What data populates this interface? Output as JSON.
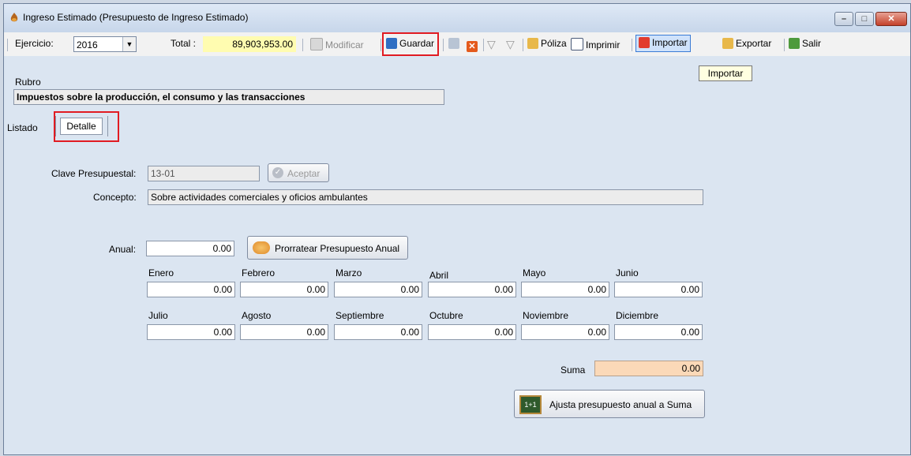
{
  "window": {
    "title": "Ingreso Estimado (Presupuesto de Ingreso Estimado)"
  },
  "toolbar": {
    "ejercicio_label": "Ejercicio:",
    "ejercicio_value": "2016",
    "total_label": "Total :",
    "total_value": "89,903,953.00",
    "modificar": "Modificar",
    "guardar": "Guardar",
    "poliza": "Póliza",
    "imprimir": "Imprimir",
    "importar": "Importar",
    "exportar": "Exportar",
    "salir": "Salir"
  },
  "tooltip": "Importar",
  "rubro": {
    "label": "Rubro",
    "value": "Impuestos sobre la producción, el consumo y las transacciones"
  },
  "tabs": {
    "listado": "Listado",
    "detalle": "Detalle"
  },
  "detalle": {
    "clave_label": "Clave Presupuestal:",
    "clave_value": "13-01",
    "aceptar": "Aceptar",
    "concepto_label": "Concepto:",
    "concepto_value": "Sobre actividades comerciales y oficios ambulantes",
    "anual_label": "Anual:",
    "anual_value": "0.00",
    "prorratear": "Prorratear Presupuesto Anual",
    "months": [
      {
        "label": "Enero",
        "value": "0.00"
      },
      {
        "label": "Febrero",
        "value": "0.00"
      },
      {
        "label": "Marzo",
        "value": "0.00"
      },
      {
        "label": "Abril",
        "value": "0.00"
      },
      {
        "label": "Mayo",
        "value": "0.00"
      },
      {
        "label": "Junio",
        "value": "0.00"
      },
      {
        "label": "Julio",
        "value": "0.00"
      },
      {
        "label": "Agosto",
        "value": "0.00"
      },
      {
        "label": "Septiembre",
        "value": "0.00"
      },
      {
        "label": "Octubre",
        "value": "0.00"
      },
      {
        "label": "Noviembre",
        "value": "0.00"
      },
      {
        "label": "Diciembre",
        "value": "0.00"
      }
    ],
    "suma_label": "Suma",
    "suma_value": "0.00",
    "ajusta": "Ajusta presupuesto anual a Suma",
    "ajusta_icon_text": "1+1"
  }
}
